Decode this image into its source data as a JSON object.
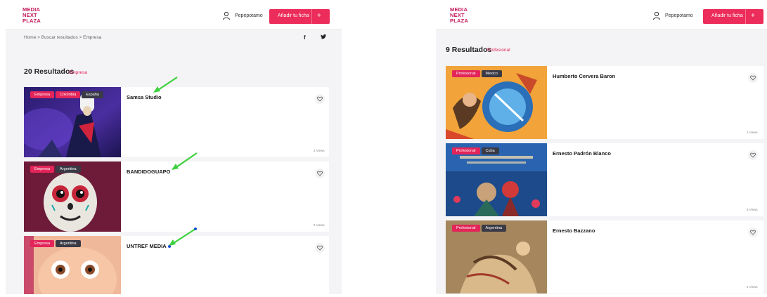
{
  "brand": {
    "logo_line1": "MEDIA",
    "logo_line2": "NEXT",
    "logo_line3": "PLAZA"
  },
  "header": {
    "username": "Pepepotamo",
    "add_button_label": "Añadir tu ficha",
    "add_button_plus": "+"
  },
  "left": {
    "breadcrumb": "Home  >  Buscar resultados  >  Empresa",
    "social": {
      "facebook": "f",
      "twitter": "🐦"
    },
    "results_count": "20 Resultados",
    "results_filter": "Empresa",
    "cards": [
      {
        "title": "Samsa Studio",
        "tags": [
          "Empresa",
          "Colombia",
          "España"
        ],
        "views": "2 Views"
      },
      {
        "title": "BANDIDOGUAPO",
        "tags": [
          "Empresa",
          "Argentina"
        ],
        "views": "9 Views"
      },
      {
        "title": "UNTREF MEDIA",
        "tags": [
          "Empresa",
          "Argentina"
        ],
        "views": ""
      }
    ]
  },
  "right": {
    "results_count": "9 Resultados",
    "results_filter": "Profesional",
    "cards": [
      {
        "title": "Humberto Cervera Baron",
        "tags": [
          "Profesional",
          "Mexico"
        ],
        "views": "2 Views"
      },
      {
        "title": "Ernesto Padrón Blanco",
        "tags": [
          "Profesional",
          "Cuba"
        ],
        "views": "6 Views"
      },
      {
        "title": "Ernesto Bazzano",
        "tags": [
          "Profesional",
          "Argentina"
        ],
        "views": "4 Views"
      }
    ]
  },
  "colors": {
    "accent": "#e3255a",
    "button": "#ec2c5a",
    "arrow": "#3dd13d"
  }
}
